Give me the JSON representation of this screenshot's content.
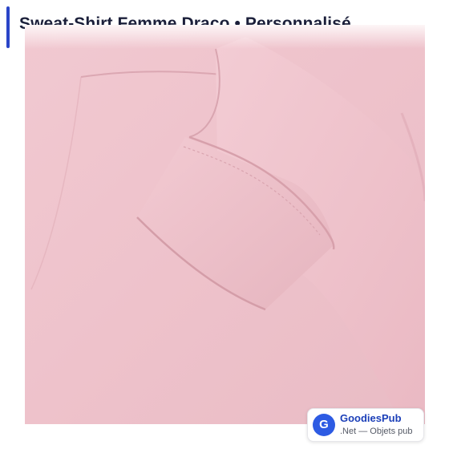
{
  "header": {
    "title": "Sweat-Shirt Femme Draco • Personnalisé"
  },
  "product_image": {
    "description_color": "#eec3cc"
  },
  "brand": {
    "logo_letter": "G",
    "name": "GoodiesPub",
    "tagline": ".Net — Objets pub",
    "accent_color": "#2d5be3"
  },
  "colors": {
    "title_accent": "#2a45c8",
    "title_text": "#1b1f3a"
  }
}
